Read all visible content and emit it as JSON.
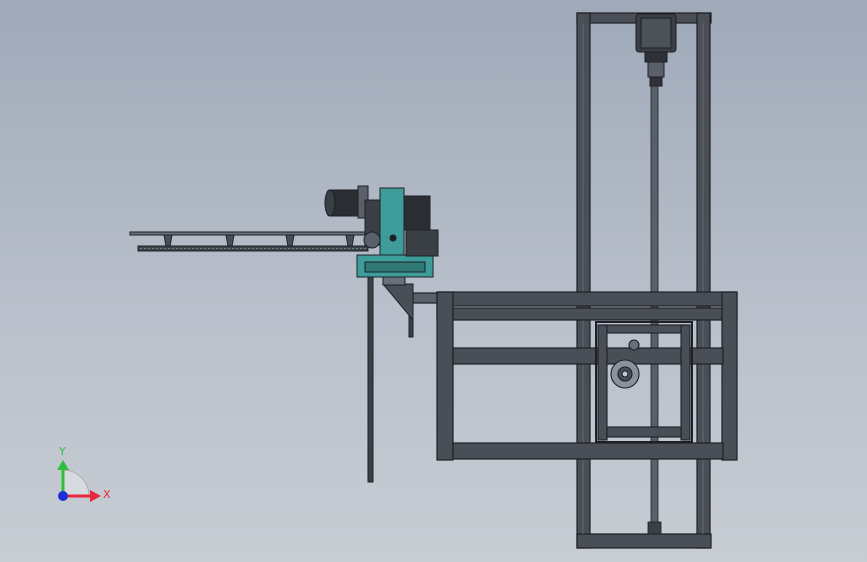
{
  "triad": {
    "x_label": "X",
    "y_label": "Y",
    "colors": {
      "x": "#e8283c",
      "y": "#2fbf3c",
      "z": "#1e2ed8"
    }
  },
  "model": {
    "frame_color": "#4a4f57",
    "frame_edge": "#1d2026",
    "accent_color": "#3e9c9a"
  }
}
